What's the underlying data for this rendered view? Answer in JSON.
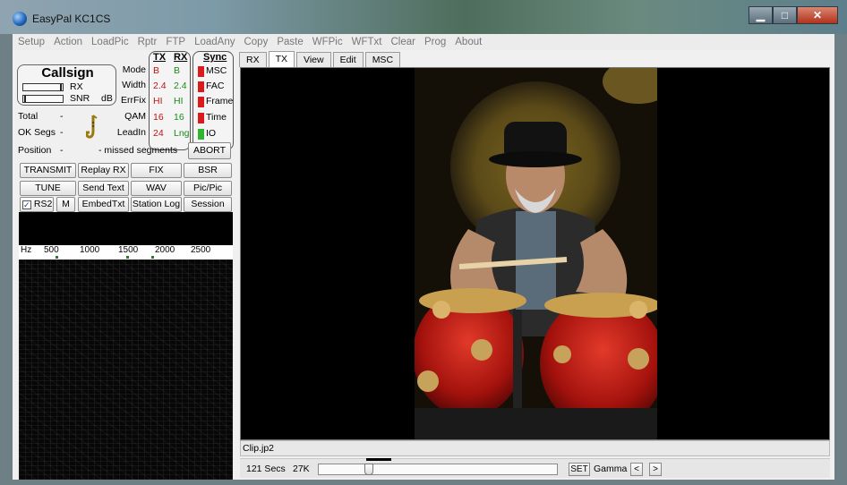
{
  "window": {
    "title": "EasyPal  KC1CS"
  },
  "menu": [
    "Setup",
    "Action",
    "LoadPic",
    "Rptr",
    "FTP",
    "LoadAny",
    "Copy",
    "Paste",
    "WFPic",
    "WFTxt",
    "Clear",
    "Prog",
    "About"
  ],
  "status": {
    "callsign": "Callsign",
    "rx_label": "RX",
    "snr_label": "SNR",
    "db_label": "dB",
    "total_label": "Total",
    "total_value": "-",
    "oksegs_label": "OK Segs",
    "oksegs_value": "-",
    "position_label": "Position",
    "position_value": "-",
    "missed_text": "- missed segments"
  },
  "params": {
    "tx_header": "TX",
    "rx_header": "RX",
    "rows": [
      {
        "label": "Mode",
        "tx": "B",
        "rx": "B"
      },
      {
        "label": "Width",
        "tx": "2.4",
        "rx": "2.4"
      },
      {
        "label": "ErrFix",
        "tx": "HI",
        "rx": "HI"
      },
      {
        "label": "QAM",
        "tx": "16",
        "rx": "16"
      },
      {
        "label": "LeadIn",
        "tx": "24",
        "rx": "Lng"
      }
    ]
  },
  "sync": {
    "header": "Sync",
    "items": [
      {
        "label": "MSC",
        "state": "off"
      },
      {
        "label": "FAC",
        "state": "off"
      },
      {
        "label": "Frame",
        "state": "off"
      },
      {
        "label": "Time",
        "state": "off"
      },
      {
        "label": "IO",
        "state": "on"
      }
    ]
  },
  "buttons": {
    "abort": "ABORT",
    "transmit": "TRANSMIT",
    "replay_rx": "Replay RX",
    "fix": "FIX",
    "bsr": "BSR",
    "tune": "TUNE",
    "send_text": "Send Text",
    "wav": "WAV",
    "picpic": "Pic/Pic",
    "rs2": "RS2",
    "m": "M",
    "embed_txt": "EmbedTxt",
    "station_log": "Station Log",
    "session": "Session"
  },
  "checkbox": {
    "rs2_checked": true,
    "check_glyph": "✓"
  },
  "spectrum_scale": {
    "hz": "Hz",
    "ticks": [
      "500",
      "1000",
      "1500",
      "2000",
      "2500"
    ]
  },
  "tabs": [
    "RX",
    "TX",
    "View",
    "Edit",
    "MSC"
  ],
  "active_tab": "TX",
  "image": {
    "filename": "Clip.jp2"
  },
  "footer": {
    "secs": "121 Secs",
    "size": "27K",
    "set": "SET",
    "gamma": "Gamma",
    "prev": "<",
    "next": ">",
    "slider_value": 0.2
  },
  "colors": {
    "tx_value": "#c01414",
    "rx_value": "#1a8a1a",
    "sync_off": "#d91b1b",
    "sync_on": "#2fb52f"
  }
}
